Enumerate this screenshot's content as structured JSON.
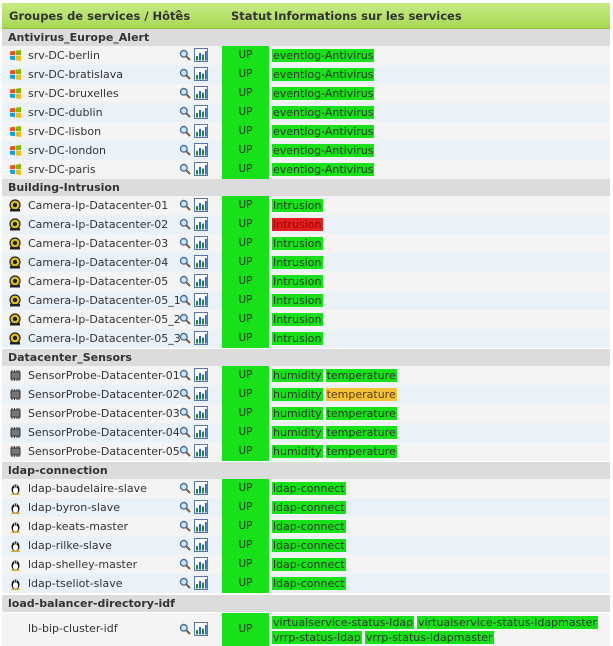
{
  "header": {
    "col_groups": "Groupes de services / Hôtes",
    "sort_indicator": "^",
    "col_status": "Statut",
    "col_info": "Informations sur les services"
  },
  "colors": {
    "ok": "#19e119",
    "critical": "#e02020",
    "warning": "#f5c13a",
    "group_bg": "#dcdcdc",
    "header_bg": "#b5e06a"
  },
  "groups": [
    {
      "name": "Antivirus_Europe_Alert",
      "host_icon": "windows-icon",
      "hosts": [
        {
          "name": "srv-DC-berlin",
          "status": "UP",
          "services": [
            {
              "label": "eventlog-Antivirus",
              "state": "ok"
            }
          ]
        },
        {
          "name": "srv-DC-bratislava",
          "status": "UP",
          "services": [
            {
              "label": "eventlog-Antivirus",
              "state": "ok"
            }
          ]
        },
        {
          "name": "srv-DC-bruxelles",
          "status": "UP",
          "services": [
            {
              "label": "eventlog-Antivirus",
              "state": "ok"
            }
          ]
        },
        {
          "name": "srv-DC-dublin",
          "status": "UP",
          "services": [
            {
              "label": "eventlog-Antivirus",
              "state": "ok"
            }
          ]
        },
        {
          "name": "srv-DC-lisbon",
          "status": "UP",
          "services": [
            {
              "label": "eventlog-Antivirus",
              "state": "ok"
            }
          ]
        },
        {
          "name": "srv-DC-london",
          "status": "UP",
          "services": [
            {
              "label": "eventlog-Antivirus",
              "state": "ok"
            }
          ]
        },
        {
          "name": "srv-DC-paris",
          "status": "UP",
          "services": [
            {
              "label": "eventlog-Antivirus",
              "state": "ok"
            }
          ]
        }
      ]
    },
    {
      "name": "Building-Intrusion",
      "host_icon": "camera-icon",
      "hosts": [
        {
          "name": "Camera-Ip-Datacenter-01",
          "status": "UP",
          "services": [
            {
              "label": "Intrusion",
              "state": "ok"
            }
          ]
        },
        {
          "name": "Camera-Ip-Datacenter-02",
          "status": "UP",
          "services": [
            {
              "label": "Intrusion",
              "state": "critical"
            }
          ]
        },
        {
          "name": "Camera-Ip-Datacenter-03",
          "status": "UP",
          "services": [
            {
              "label": "Intrusion",
              "state": "ok"
            }
          ]
        },
        {
          "name": "Camera-Ip-Datacenter-04",
          "status": "UP",
          "services": [
            {
              "label": "Intrusion",
              "state": "ok"
            }
          ]
        },
        {
          "name": "Camera-Ip-Datacenter-05",
          "status": "UP",
          "services": [
            {
              "label": "Intrusion",
              "state": "ok"
            }
          ]
        },
        {
          "name": "Camera-Ip-Datacenter-05_1",
          "status": "UP",
          "services": [
            {
              "label": "Intrusion",
              "state": "ok"
            }
          ]
        },
        {
          "name": "Camera-Ip-Datacenter-05_2",
          "status": "UP",
          "services": [
            {
              "label": "Intrusion",
              "state": "ok"
            }
          ]
        },
        {
          "name": "Camera-Ip-Datacenter-05_3",
          "status": "UP",
          "services": [
            {
              "label": "Intrusion",
              "state": "ok"
            }
          ]
        }
      ]
    },
    {
      "name": "Datacenter_Sensors",
      "host_icon": "chip-icon",
      "hosts": [
        {
          "name": "SensorProbe-Datacenter-01",
          "status": "UP",
          "services": [
            {
              "label": "humidity",
              "state": "ok"
            },
            {
              "label": "temperature",
              "state": "ok"
            }
          ]
        },
        {
          "name": "SensorProbe-Datacenter-02",
          "status": "UP",
          "services": [
            {
              "label": "humidity",
              "state": "ok"
            },
            {
              "label": "temperature",
              "state": "warning"
            }
          ]
        },
        {
          "name": "SensorProbe-Datacenter-03",
          "status": "UP",
          "services": [
            {
              "label": "humidity",
              "state": "ok"
            },
            {
              "label": "temperature",
              "state": "ok"
            }
          ]
        },
        {
          "name": "SensorProbe-Datacenter-04",
          "status": "UP",
          "services": [
            {
              "label": "humidity",
              "state": "ok"
            },
            {
              "label": "temperature",
              "state": "ok"
            }
          ]
        },
        {
          "name": "SensorProbe-Datacenter-05",
          "status": "UP",
          "services": [
            {
              "label": "humidity",
              "state": "ok"
            },
            {
              "label": "temperature",
              "state": "ok"
            }
          ]
        }
      ]
    },
    {
      "name": "ldap-connection",
      "host_icon": "linux-tux-icon",
      "hosts": [
        {
          "name": "ldap-baudelaire-slave",
          "status": "UP",
          "services": [
            {
              "label": "ldap-connect",
              "state": "ok"
            }
          ]
        },
        {
          "name": "ldap-byron-slave",
          "status": "UP",
          "services": [
            {
              "label": "ldap-connect",
              "state": "ok"
            }
          ]
        },
        {
          "name": "ldap-keats-master",
          "status": "UP",
          "services": [
            {
              "label": "ldap-connect",
              "state": "ok"
            }
          ]
        },
        {
          "name": "ldap-rilke-slave",
          "status": "UP",
          "services": [
            {
              "label": "ldap-connect",
              "state": "ok"
            }
          ]
        },
        {
          "name": "ldap-shelley-master",
          "status": "UP",
          "services": [
            {
              "label": "ldap-connect",
              "state": "ok"
            }
          ]
        },
        {
          "name": "ldap-tseliot-slave",
          "status": "UP",
          "services": [
            {
              "label": "ldap-connect",
              "state": "ok"
            }
          ]
        }
      ]
    },
    {
      "name": "load-balancer-directory-idf",
      "host_icon": "none",
      "hosts": [
        {
          "name": "lb-bip-cluster-idf",
          "status": "UP",
          "services": [
            {
              "label": "virtualservice-status-ldap",
              "state": "ok"
            },
            {
              "label": "virtualservice-status-ldapmaster",
              "state": "ok"
            },
            {
              "label": "vrrp-status-ldap",
              "state": "ok"
            },
            {
              "label": "vrrp-status-ldapmaster",
              "state": "ok"
            }
          ]
        }
      ]
    }
  ]
}
